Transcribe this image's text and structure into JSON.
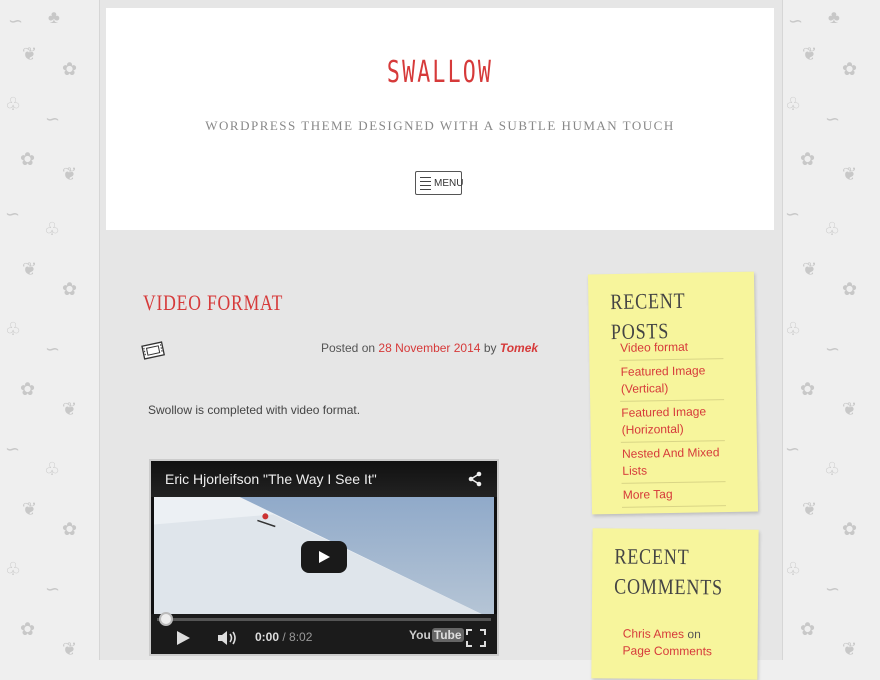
{
  "site": {
    "title": "Swallow",
    "description": "WordPress Theme designed with a subtle human touch",
    "menu_label": "MENU"
  },
  "post": {
    "title": "Video format",
    "format_icon": "film-icon",
    "posted_on_label": "Posted on",
    "date": "28 November 2014",
    "by_label": "by",
    "author": "Tomek",
    "body": "Swollow is completed with video format."
  },
  "video": {
    "title": "Eric Hjorleifson \"The Way I See It\"",
    "current_time": "0:00",
    "duration": "/ 8:02",
    "progress": 0,
    "logo_you": "You",
    "logo_tube": "Tube"
  },
  "sidebar": {
    "recent_posts": {
      "title": "Recent Posts",
      "items": [
        {
          "label": "Video format"
        },
        {
          "label": "Featured Image (Vertical)"
        },
        {
          "label": "Featured Image (Horizontal)"
        },
        {
          "label": "Nested And Mixed Lists"
        },
        {
          "label": "More Tag"
        }
      ]
    },
    "recent_comments": {
      "title": "Recent Comments",
      "items": [
        {
          "author": "Chris Ames",
          "on_label": "on",
          "post": "Page Comments"
        }
      ]
    }
  },
  "colors": {
    "accent": "#d63a3a",
    "note": "#f7f59c",
    "page_bg": "#e6e6e6"
  }
}
